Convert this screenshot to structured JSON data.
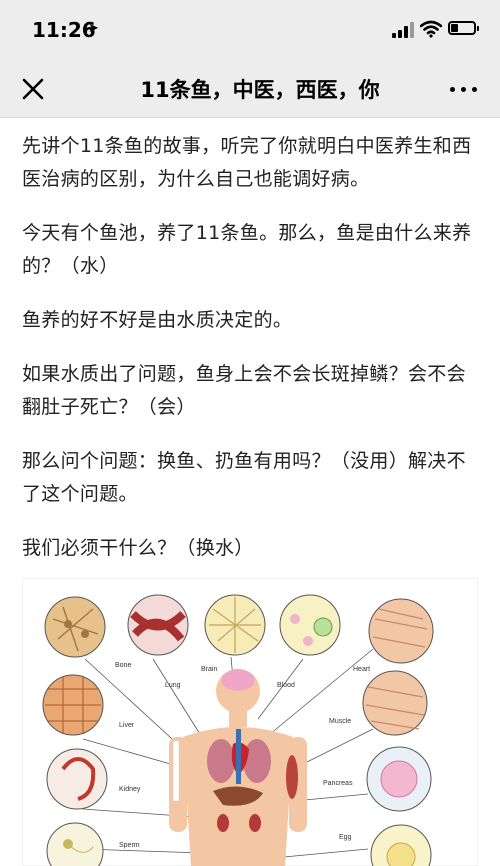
{
  "status_bar": {
    "time": "11:26",
    "location_icon": "location-arrow-icon",
    "signal_icon": "cellular-signal-icon",
    "wifi_icon": "wifi-icon",
    "battery_icon": "battery-icon",
    "battery_level": 0.3
  },
  "nav": {
    "close_icon": "close-icon",
    "title": "11条鱼，中医，西医，你",
    "more_icon": "more-dots-icon"
  },
  "article": {
    "paragraphs": [
      "先讲个11条鱼的故事，听完了你就明白中医养生和西医治病的区别，为什么自己也能调好病。",
      "今天有个鱼池，养了11条鱼。那么，鱼是由什么来养的？（水）",
      "鱼养的好不好是由水质决定的。",
      "如果水质出了问题，鱼身上会不会长斑掉鳞？会不会翻肚子死亡？（会）",
      "那么问个问题：换鱼、扔鱼有用吗？（没用）解决不了这个问题。",
      "我们必须干什么？（换水）"
    ]
  },
  "figure": {
    "labels": {
      "bone": "Bone",
      "lung": "Lung",
      "brain": "Brain",
      "blood": "Blood",
      "heart": "Heart",
      "liver": "Liver",
      "muscle": "Muscle",
      "kidney": "Kidney",
      "pancreas": "Pancreas",
      "sperm": "Sperm",
      "egg": "Egg"
    }
  },
  "colors": {
    "bar_background": "#ededed",
    "text": "#222222",
    "skin": "#f3c7a4"
  }
}
